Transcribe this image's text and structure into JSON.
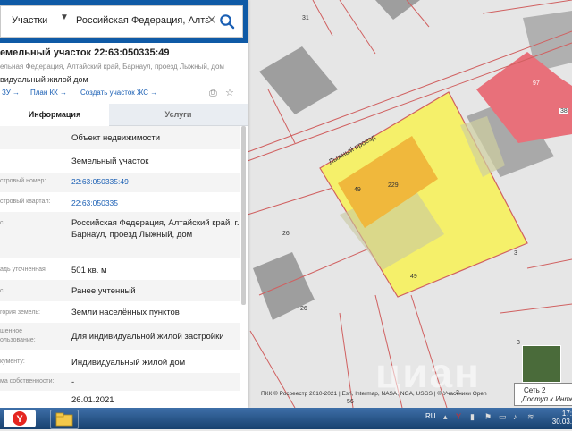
{
  "search": {
    "category": "Участки",
    "query": "Российская Федерация, Алтаі"
  },
  "parcel": {
    "title": "емельный участок 22:63:050335:49",
    "address": "ельная Федерация, Алтайский край, Барнаул, проезд Лыжный, дом",
    "use": "видуальный жилой дом",
    "links": {
      "l1": "ЗУ →",
      "l2": "План КК →",
      "l3": "Создать участок ЖС →"
    }
  },
  "tabs": {
    "info": "Информация",
    "services": "Услуги"
  },
  "rows": [
    {
      "label": "",
      "value": "Объект недвижимости"
    },
    {
      "label": "",
      "value": "Земельный участок"
    },
    {
      "label": "стровый номер:",
      "value": "22:63:050335:49"
    },
    {
      "label": "стровый квартал:",
      "value": "22:63:050335"
    },
    {
      "label": "с:",
      "value": "Российская Федерация, Алтайский край, г. Барнаул, проезд Лыжный, дом"
    },
    {
      "label": "адь уточненная",
      "value": "501 кв. м"
    },
    {
      "label": "с:",
      "value": "Ранее учтенный"
    },
    {
      "label": "гория земель:",
      "value": "Земли населённых пунктов"
    },
    {
      "label": "шенное\nользование:",
      "value": "Для индивидуальной жилой застройки"
    },
    {
      "label": "кументу:",
      "value": "Индивидуальный жилой дом"
    },
    {
      "label": "ма собственности:",
      "value": "-"
    },
    {
      "label": "",
      "value": "26.01.2021"
    }
  ],
  "map_labels": {
    "street": "Лыжный проезд",
    "n31": "31",
    "n97": "97",
    "n38": "38",
    "n26a": "26",
    "n26b": "26",
    "n49a": "49",
    "n229": "229",
    "n49b": "49",
    "n3a": "3",
    "n3b": "3",
    "n2": "2",
    "n56": "56"
  },
  "attribution": "ПКК © Росреестр 2010-2021 | Esri, Intermap, NASA, NGA, USGS | © Участники Open",
  "watermark": "циан",
  "tooltip": {
    "line1": "Сеть 2",
    "line2": "Доступ к Инте"
  },
  "taskbar": {
    "lang": "RU",
    "time": "17:",
    "date": "30.03."
  },
  "colors": {
    "header": "#0f5aa6",
    "link": "#1a5fb4",
    "parcel": "#f5f06a",
    "building": "#e8707a"
  }
}
